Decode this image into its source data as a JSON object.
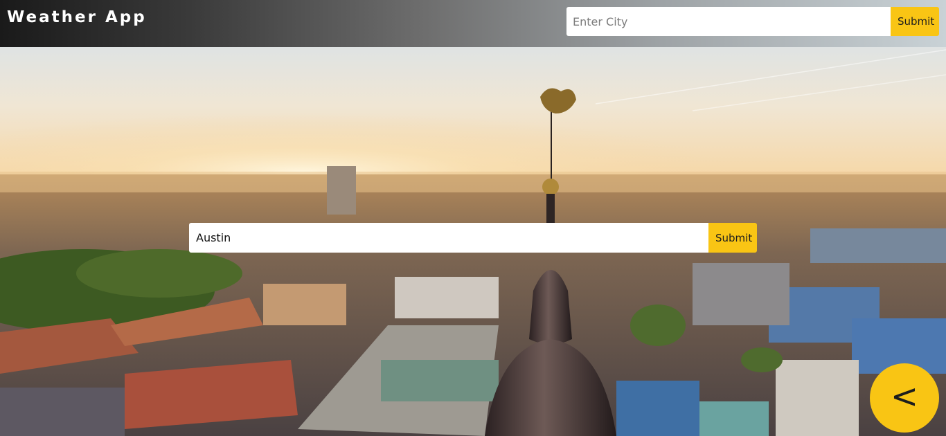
{
  "header": {
    "brand": "Weather App",
    "search": {
      "placeholder": "Enter City",
      "value": "",
      "submit_label": "Submit"
    }
  },
  "main": {
    "search": {
      "value": "Austin",
      "placeholder": "",
      "submit_label": "Submit"
    }
  },
  "fab": {
    "label": "<",
    "icon": "chevron-left-icon"
  },
  "colors": {
    "accent": "#f9c514",
    "header_dark": "#1a1a1a",
    "header_light": "#c9d2d6"
  }
}
